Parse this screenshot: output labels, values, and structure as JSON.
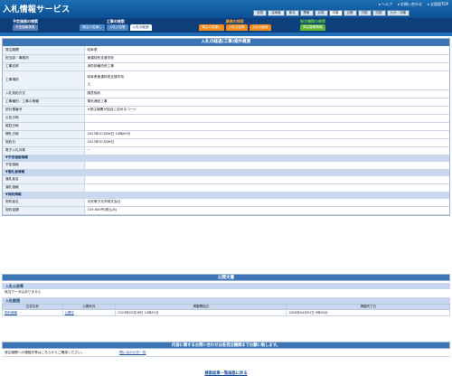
{
  "header": {
    "logo": "入札情報サービス",
    "links": [
      "ヘルプ",
      "お問い合わせ",
      "全国版TOP"
    ],
    "regions": [
      "全国",
      "北海道",
      "東北",
      "関東",
      "北陸",
      "中部",
      "近畿",
      "中国",
      "四国",
      "九州・沖縄"
    ],
    "region_selected": "中部"
  },
  "nav": {
    "groups": [
      {
        "title": "予定価格の検索",
        "tabs": [
          "予定価格検索"
        ]
      },
      {
        "title": "工事の検索",
        "tabs": [
          "発注の見通し",
          "入札公告等",
          "入札の経過"
        ]
      },
      {
        "title": "業務の検索",
        "tabs": [
          "発注の見通し",
          "入札公告等",
          "入札の経過"
        ]
      },
      {
        "title": "発注機関の検索",
        "tabs": [
          "発注機関情報"
        ]
      }
    ],
    "active_tab": "入札の経過"
  },
  "main": {
    "title": "入札の経過(工事)案件概要",
    "rows": [
      {
        "label": "発注機関",
        "value": "岐阜県"
      },
      {
        "label": "担当部・事務所",
        "value": "東濃特別支援学校"
      },
      {
        "label": "工事名称",
        "value": "消防設備改修工事"
      },
      {
        "label": "工事場所",
        "value": "岐阜県東濃特別支援学校",
        "value2": "土"
      },
      {
        "label": "入札契約方式",
        "value": "随意契約"
      },
      {
        "label": "工事種別／工事の業種",
        "value": "電気通信工事"
      },
      {
        "label": "設計書番号",
        "value": "※発注機関が独自に定めるコード"
      },
      {
        "label": "公告日時",
        "value": ""
      },
      {
        "label": "縦覧日時",
        "value": ""
      },
      {
        "label": "開札日時",
        "value": "2023年01月06日 10時00分"
      },
      {
        "label": "契約日",
        "value": "2023年01月06日"
      },
      {
        "label": "電子入札対象",
        "value": "－"
      }
    ],
    "group_yotei": "予定価格情報",
    "row_yotei": {
      "label": "予定価格",
      "value": ""
    },
    "group_rakusatsu": "落札者情報",
    "rows_rakusatsu": [
      {
        "label": "落札者名",
        "value": ""
      },
      {
        "label": "落札価格",
        "value": ""
      }
    ],
    "group_keiyaku": "契約情報",
    "rows_keiyaku": [
      {
        "label": "契約者名",
        "value": "中央電子光学株式会社"
      },
      {
        "label": "契約金額",
        "value": "105,600円(税込み)"
      }
    ]
  },
  "kokai": {
    "title": "公開文書",
    "koukoku_title": "入札公告等",
    "koukoku_empty": "該当データはありません",
    "keika_title": "入札経過",
    "columns": [
      "文書名称",
      "公開状況",
      "掲載開始日",
      "掲載終了日"
    ],
    "files": [
      {
        "name": "契約情報",
        "status": "公開中",
        "start": "2023年02月28日 10時51分",
        "end": "2026年04月01日 0時00分"
      }
    ]
  },
  "contact": {
    "title": "内容に関するお問い合わせは各発注機関までお願い致します。",
    "label": "発注機関への連絡先等はこちらからご確認ください。",
    "link": "問い合わせ先一覧"
  },
  "back_link": "検索結果一覧画面に戻る",
  "colors": {
    "header": "#0b4f94",
    "section": "#3c76b6",
    "works": "#f28a1c",
    "agency": "#5cb531"
  }
}
